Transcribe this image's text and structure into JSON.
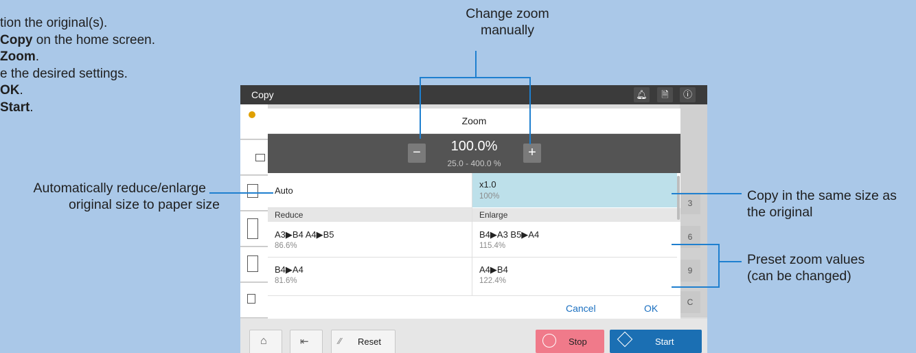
{
  "steps": [
    {
      "prefix": "tion the original(s).",
      "bold": "",
      "suffix": ""
    },
    {
      "prefix": "",
      "bold": "Copy",
      "suffix": " on the home screen."
    },
    {
      "prefix": "",
      "bold": "Zoom",
      "suffix": "."
    },
    {
      "prefix": "e the desired settings.",
      "bold": "",
      "suffix": ""
    },
    {
      "prefix": "",
      "bold": "OK",
      "suffix": "."
    },
    {
      "prefix": "",
      "bold": "Start",
      "suffix": "."
    }
  ],
  "annotations": {
    "change_zoom": [
      "Change zoom",
      "manually"
    ],
    "auto": [
      "Automatically reduce/enlarge",
      "original size to paper size"
    ],
    "same_size": [
      "Copy in the same size as",
      "the original"
    ],
    "preset": [
      "Preset zoom values",
      "(can be changed)"
    ]
  },
  "device": {
    "title": "Copy",
    "icons": [
      "bell-icon",
      "job-status-icon",
      "info-icon"
    ],
    "right_numbers": [
      "3",
      "6",
      "9",
      "C"
    ],
    "bottom": {
      "home_icon": "home-icon",
      "exit_icon": "exit-icon",
      "reset_label": "Reset",
      "stop_label": "Stop",
      "start_label": "Start"
    }
  },
  "dialog": {
    "title": "Zoom",
    "value": "100.0%",
    "range": "25.0  -  400.0 %",
    "minus": "−",
    "plus": "+",
    "auto_label": "Auto",
    "x1_label": "x1.0",
    "x1_sub": "100%",
    "reduce_header": "Reduce",
    "enlarge_header": "Enlarge",
    "presets": [
      {
        "label": "A3▶B4  A4▶B5",
        "value": "86.6%"
      },
      {
        "label": "B4▶A3  B5▶A4",
        "value": "115.4%"
      },
      {
        "label": "B4▶A4",
        "value": "81.6%"
      },
      {
        "label": "A4▶B4",
        "value": "122.4%"
      }
    ],
    "cancel": "Cancel",
    "ok": "OK"
  },
  "colors": {
    "background": "#aac8e8",
    "accent_line": "#1e7fcf",
    "highlight": "#bde0ea",
    "stop": "#f07a8a",
    "start": "#1b6fb3"
  }
}
